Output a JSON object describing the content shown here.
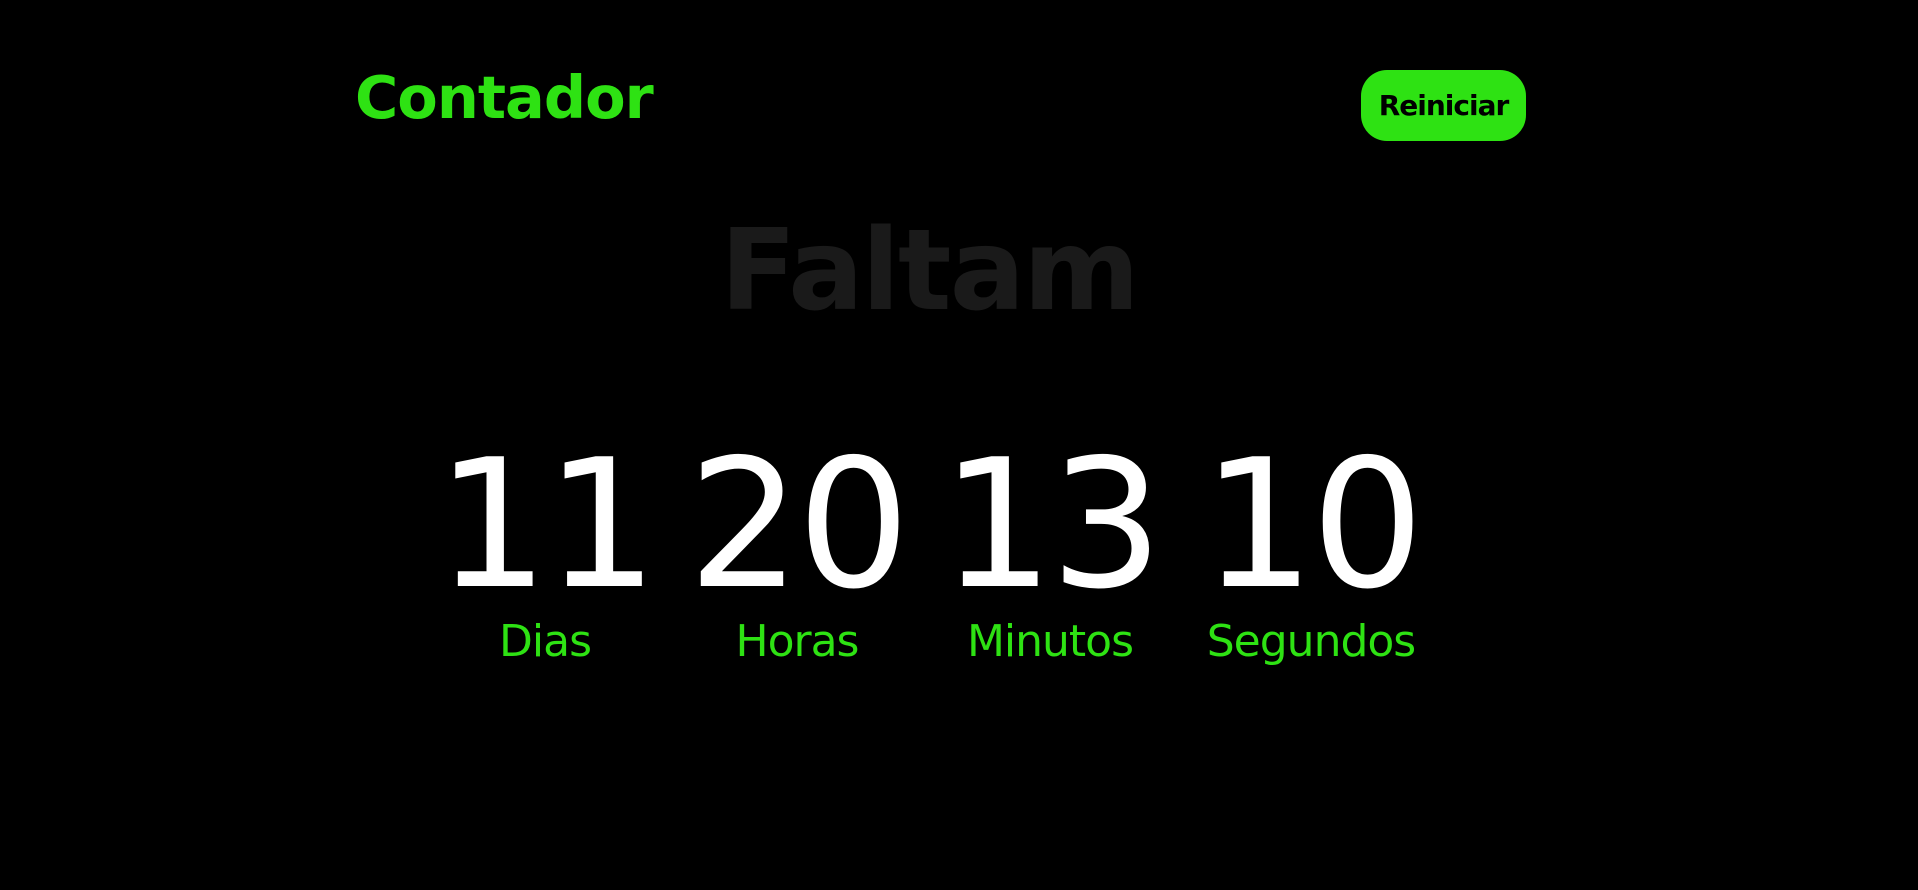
{
  "header": {
    "title": "Contador",
    "restart_label": "Reiniciar"
  },
  "countdown": {
    "heading": "Faltam",
    "units": [
      {
        "value": "11",
        "label": "Dias"
      },
      {
        "value": "20",
        "label": "Horas"
      },
      {
        "value": "13",
        "label": "Minutos"
      },
      {
        "value": "10",
        "label": "Segundos"
      }
    ]
  },
  "colors": {
    "background": "#000000",
    "accent": "#2ee213",
    "digits": "#ffffff",
    "heading": "#1a1a1a"
  }
}
